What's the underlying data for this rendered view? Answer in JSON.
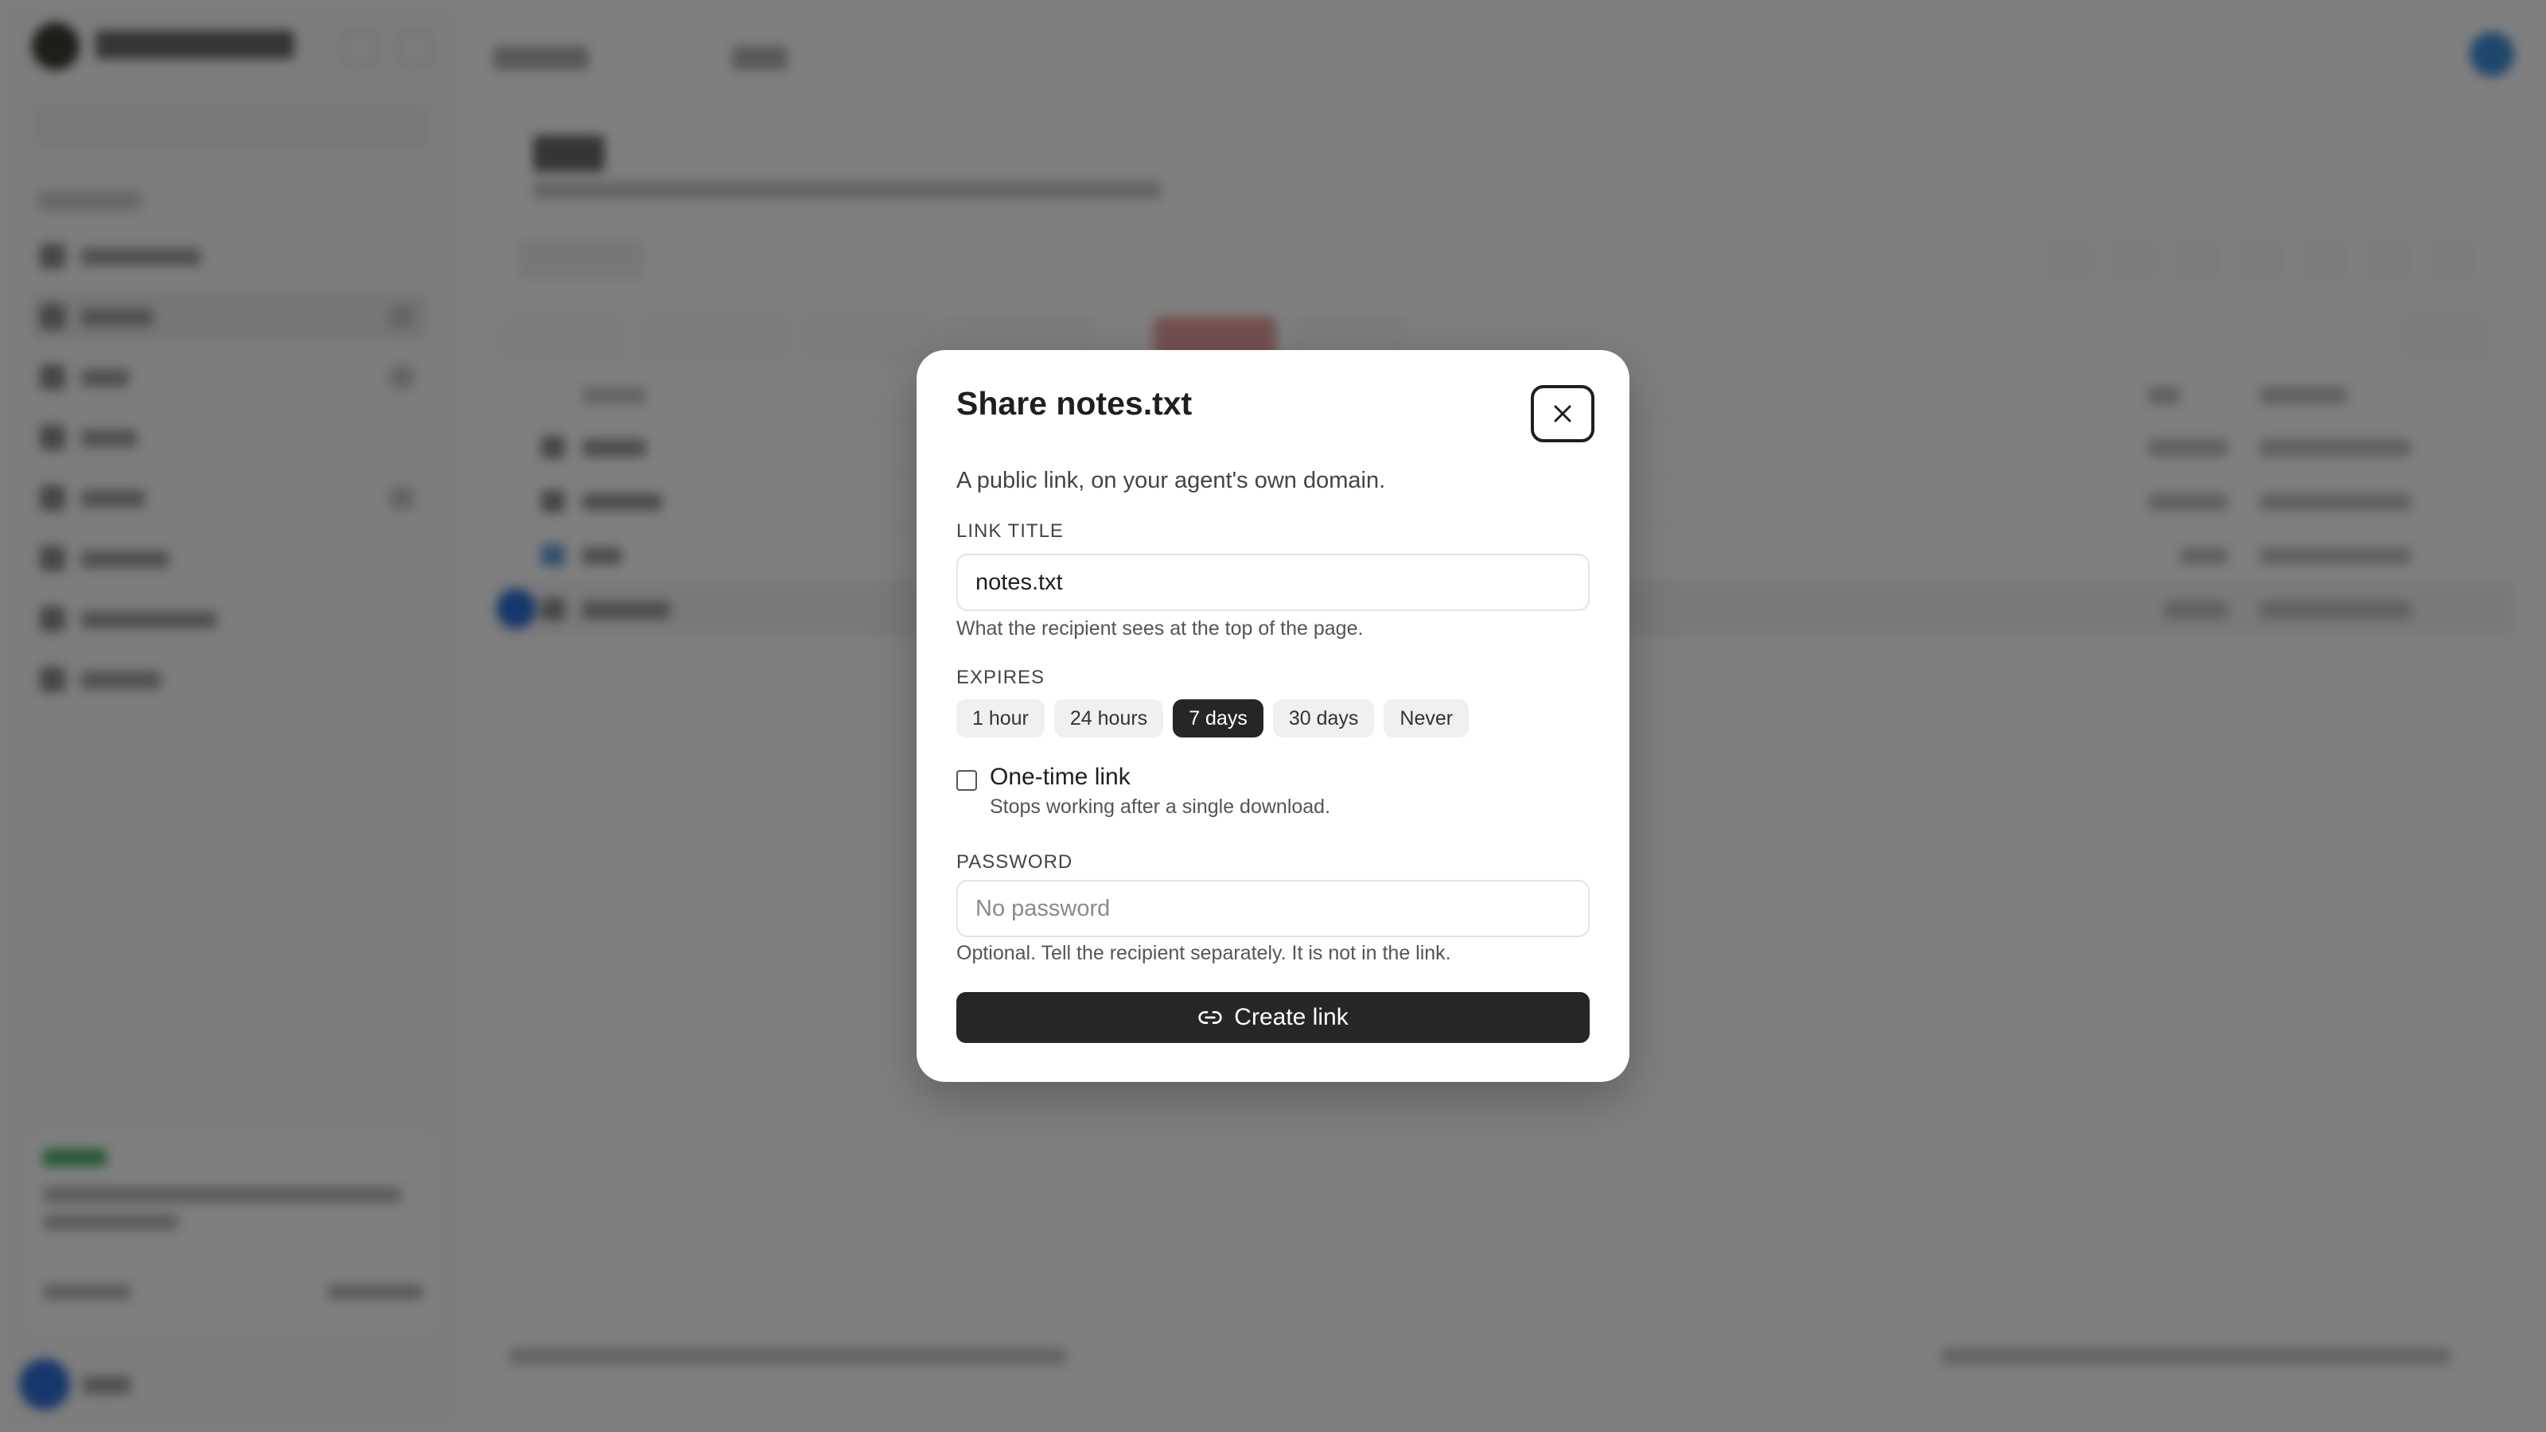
{
  "modal": {
    "title": "Share notes.txt",
    "description": "A public link, on your agent's own domain.",
    "link_title": {
      "label": "LINK TITLE",
      "value": "notes.txt",
      "help": "What the recipient sees at the top of the page."
    },
    "expires": {
      "label": "EXPIRES",
      "options": [
        "1 hour",
        "24 hours",
        "7 days",
        "30 days",
        "Never"
      ],
      "selected": "7 days"
    },
    "one_time": {
      "label": "One-time link",
      "help": "Stops working after a single download.",
      "checked": false
    },
    "password": {
      "label": "PASSWORD",
      "placeholder": "No password",
      "help": "Optional. Tell the recipient separately. It is not in the link."
    },
    "create_label": "Create link"
  },
  "colors": {
    "overlay": "rgba(0,0,0,0.5)",
    "primary_button": "#262626",
    "selected_pill": "#262626"
  },
  "icons": {
    "close": "close-icon",
    "create": "link-icon"
  }
}
